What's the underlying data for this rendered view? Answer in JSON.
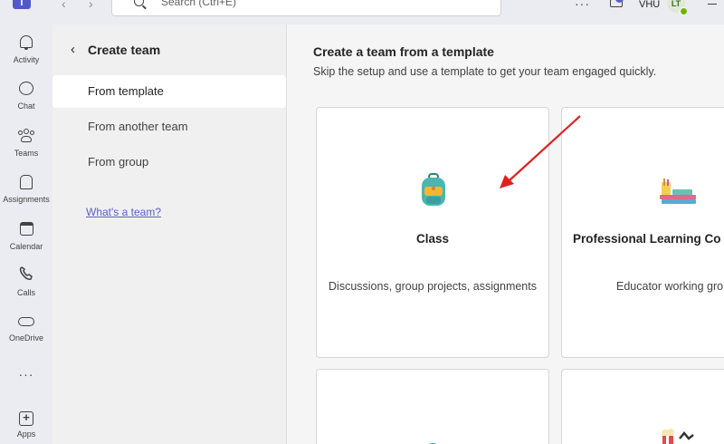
{
  "topbar": {
    "logo_text": "T",
    "search_placeholder": "Search (Ctrl+E)",
    "more": "···",
    "user_label": "VHU",
    "avatar_initials": "LT"
  },
  "rail": {
    "items": [
      {
        "label": "Activity",
        "icon": "bell-icon"
      },
      {
        "label": "Chat",
        "icon": "chat-icon"
      },
      {
        "label": "Teams",
        "icon": "teams-icon"
      },
      {
        "label": "Assignments",
        "icon": "backpack-icon"
      },
      {
        "label": "Calendar",
        "icon": "calendar-icon"
      },
      {
        "label": "Calls",
        "icon": "phone-icon"
      },
      {
        "label": "OneDrive",
        "icon": "cloud-icon"
      },
      {
        "label": "",
        "icon": "more-icon"
      },
      {
        "label": "Apps",
        "icon": "plus-icon"
      }
    ],
    "more_glyph": "···"
  },
  "leftpanel": {
    "back_glyph": "‹",
    "title": "Create team",
    "items": [
      {
        "label": "From template",
        "selected": true
      },
      {
        "label": "From another team",
        "selected": false
      },
      {
        "label": "From group",
        "selected": false
      }
    ],
    "help_link": "What's a team?"
  },
  "main": {
    "title": "Create a team from a template",
    "subtitle": "Skip the setup and use a template to get your team engaged quickly.",
    "cards": [
      {
        "title": "Class",
        "description": "Discussions, group projects, assignments",
        "icon": "backpack-icon"
      },
      {
        "title": "Professional Learning Co",
        "description": "Educator working gro",
        "icon": "books-icon"
      },
      {
        "title": "",
        "description": "",
        "icon": "partial-icon"
      },
      {
        "title": "",
        "description": "",
        "icon": "popcorn-icon"
      }
    ]
  },
  "colors": {
    "accent": "#5b5fc7",
    "arrow": "#e02020",
    "presence": "#6bb700"
  }
}
